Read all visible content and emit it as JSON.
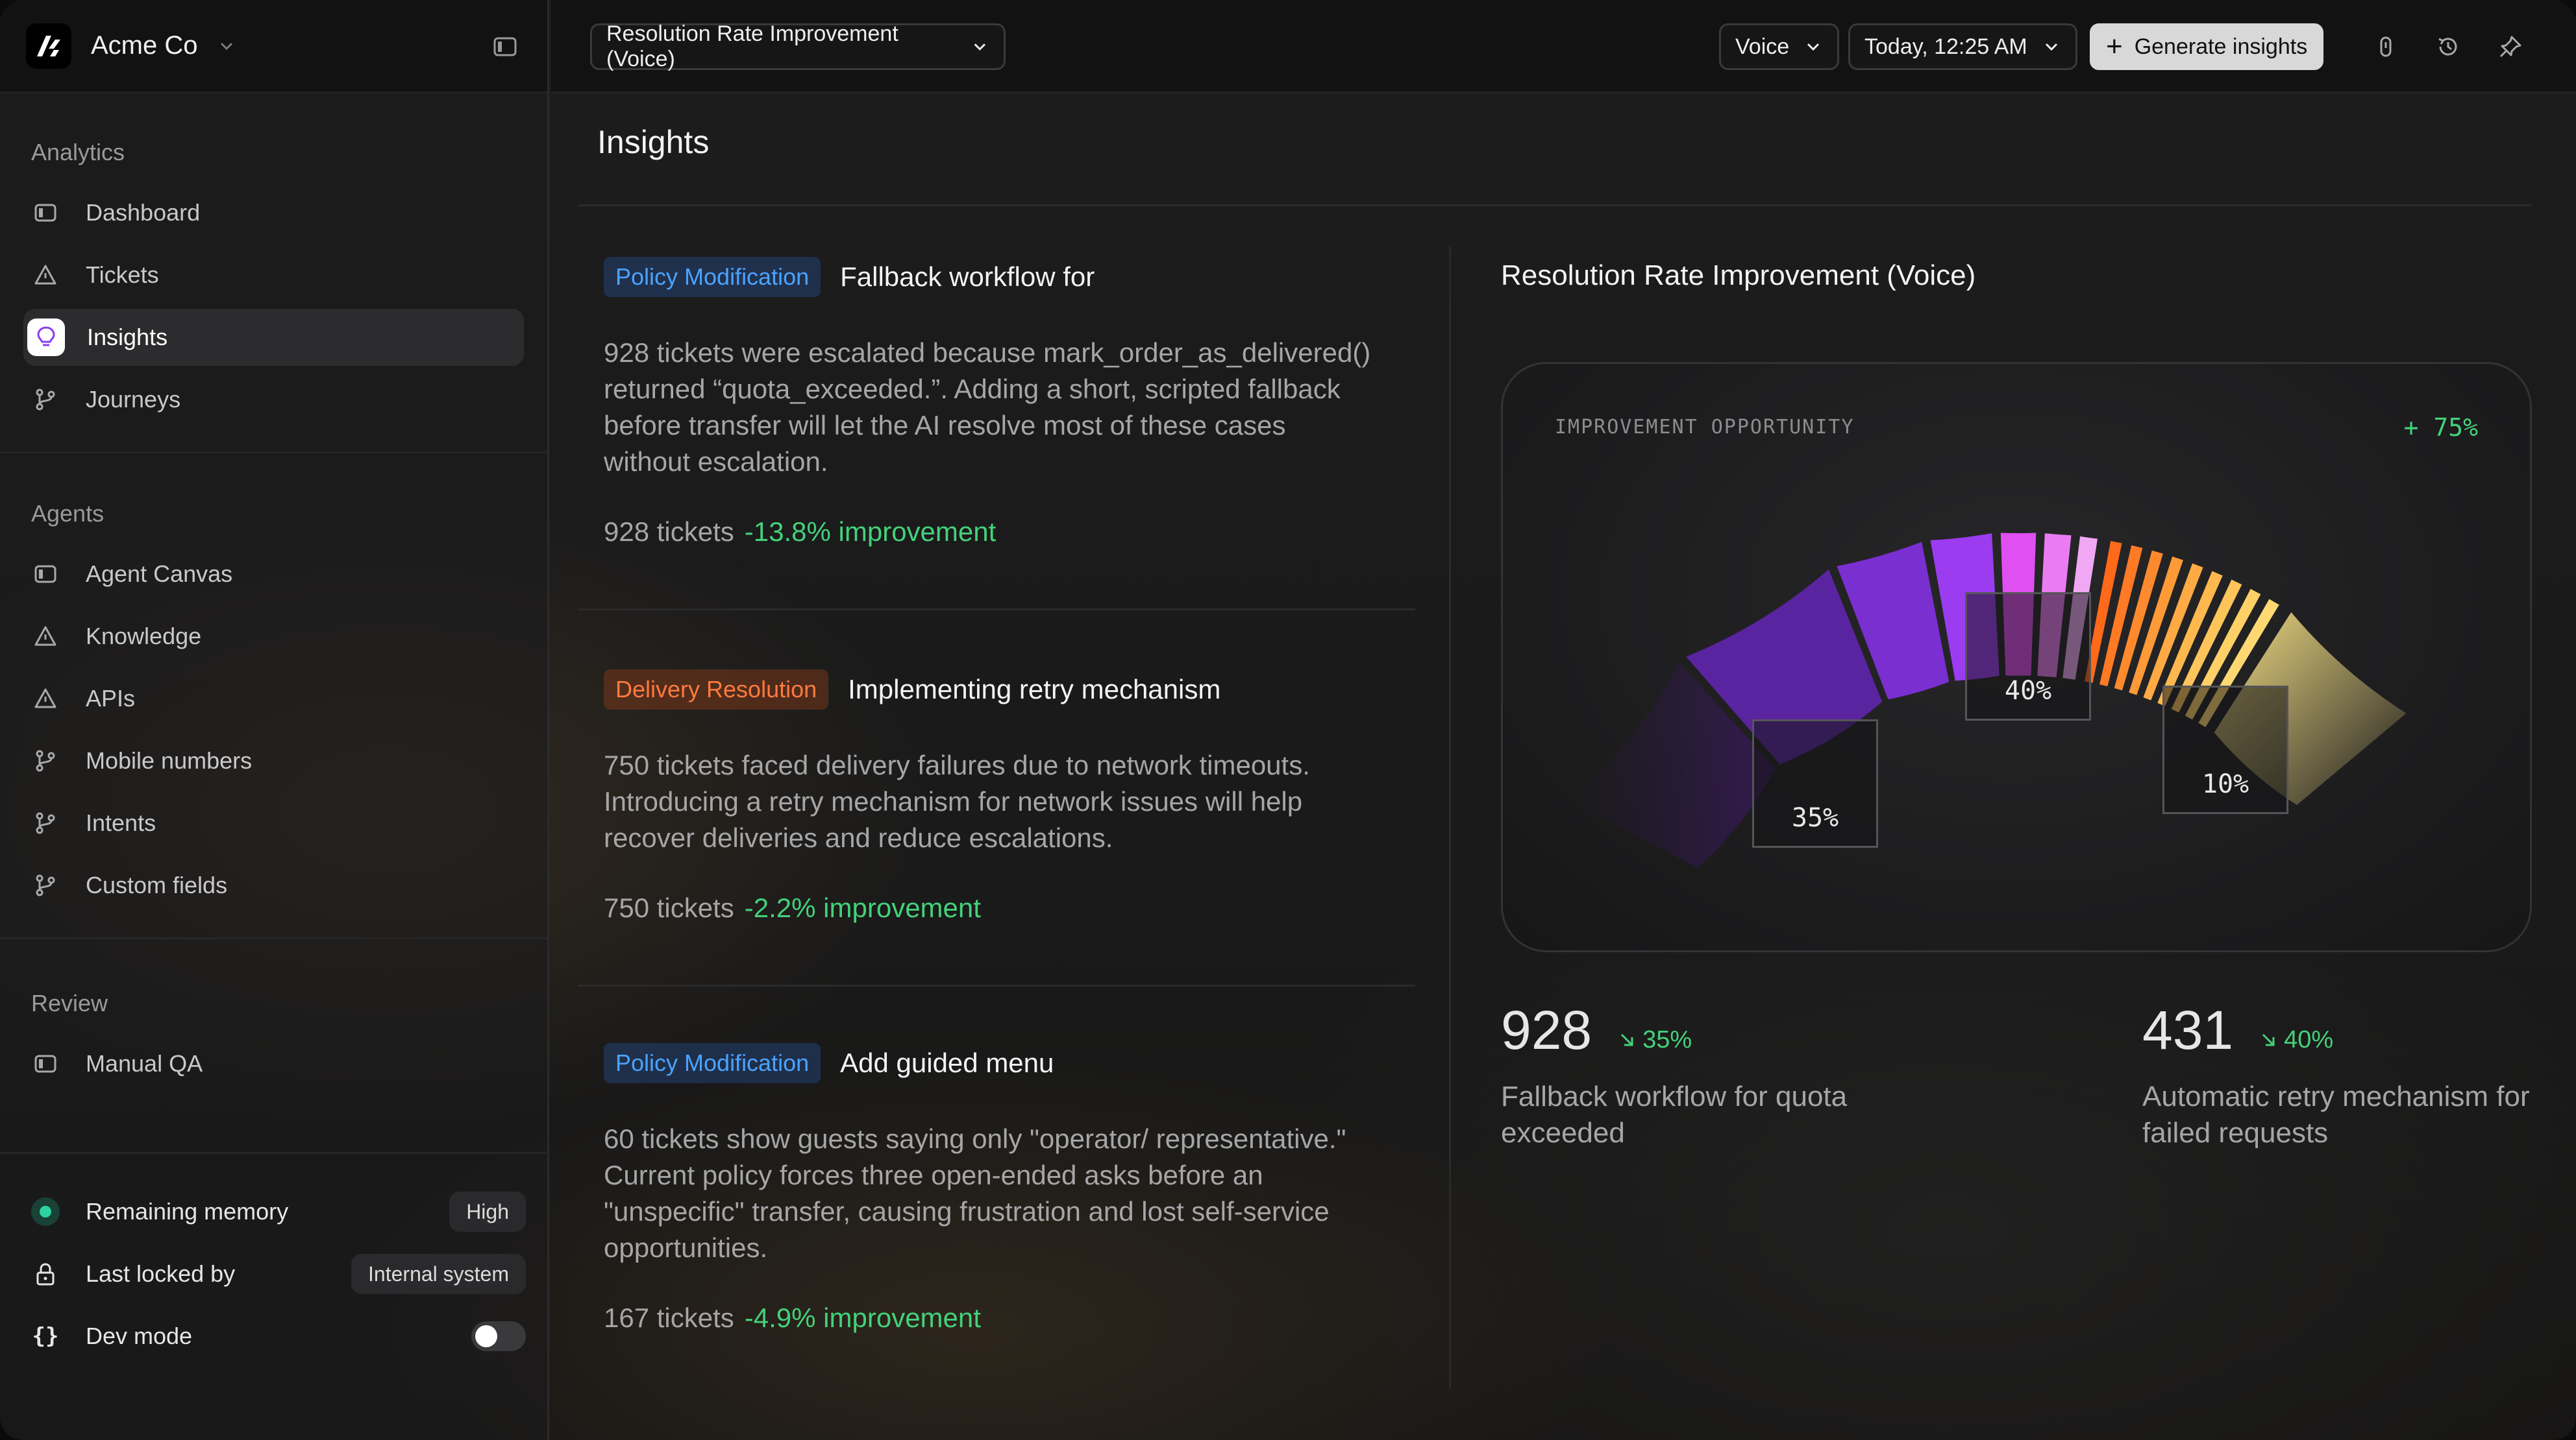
{
  "org": {
    "name": "Acme Co"
  },
  "sidebar": {
    "groups": [
      {
        "title": "Analytics",
        "items": [
          {
            "label": "Dashboard"
          },
          {
            "label": "Tickets"
          },
          {
            "label": "Insights"
          },
          {
            "label": "Journeys"
          }
        ]
      },
      {
        "title": "Agents",
        "items": [
          {
            "label": "Agent Canvas"
          },
          {
            "label": "Knowledge"
          },
          {
            "label": "APIs"
          },
          {
            "label": "Mobile numbers"
          },
          {
            "label": "Intents"
          },
          {
            "label": "Custom fields"
          }
        ]
      },
      {
        "title": "Review",
        "items": [
          {
            "label": "Manual QA"
          }
        ]
      }
    ],
    "bottom": {
      "memory_label": "Remaining memory",
      "memory_value": "High",
      "locked_label": "Last locked by",
      "locked_value": "Internal system",
      "dev_label": "Dev mode",
      "dev_on": false
    }
  },
  "topbar": {
    "report_select": "Resolution Rate Improvement (Voice)",
    "channel_select": "Voice",
    "date_select": "Today, 12:25 AM",
    "generate_label": "Generate insights"
  },
  "main": {
    "title": "Insights",
    "insights": [
      {
        "tag": "Policy Modification",
        "tag_color": "blue",
        "title": "Fallback workflow for",
        "body": "928 tickets were escalated because mark_order_as_delivered() returned “quota_exceeded.”. Adding a short, scripted fallback before transfer will let the AI resolve most of these cases without escalation.",
        "tickets": "928 tickets",
        "improvement": "-13.8% improvement"
      },
      {
        "tag": "Delivery Resolution",
        "tag_color": "orange",
        "title": "Implementing retry mechanism",
        "body": "750 tickets faced delivery failures due to network timeouts. Introducing a retry mechanism for network issues will help recover deliveries and reduce escalations.",
        "tickets": "750 tickets",
        "improvement": "-2.2% improvement"
      },
      {
        "tag": "Policy Modification",
        "tag_color": "blue",
        "title": "Add guided menu",
        "body": "60 tickets show guests saying only \"operator/ representative.\" Current policy forces three open-ended asks before an \"unspecific\" transfer, causing frustration and lost self-service opportunities.",
        "tickets": "167 tickets",
        "improvement": "-4.9% improvement"
      }
    ]
  },
  "chart": {
    "title": "Resolution Rate Improvement (Voice)",
    "card_label": "IMPROVEMENT OPPORTUNITY",
    "card_pct": "+ 75%",
    "callouts": [
      {
        "label": "35%"
      },
      {
        "label": "40%"
      },
      {
        "label": "10%"
      }
    ]
  },
  "chart_data": {
    "type": "gauge",
    "segments": [
      {
        "label": "35%",
        "value": 35
      },
      {
        "label": "40%",
        "value": 40
      },
      {
        "label": "10%",
        "value": 10
      }
    ]
  },
  "stats": [
    {
      "value": "928",
      "delta": "35%",
      "label": "Fallback workflow for quota exceeded"
    },
    {
      "value": "431",
      "delta": "40%",
      "label": "Automatic retry mechanism for failed requests"
    }
  ],
  "colors": {
    "accent_green": "#44d17a",
    "tag_blue": "#4aa3ff",
    "tag_orange": "#ff7a3d"
  }
}
